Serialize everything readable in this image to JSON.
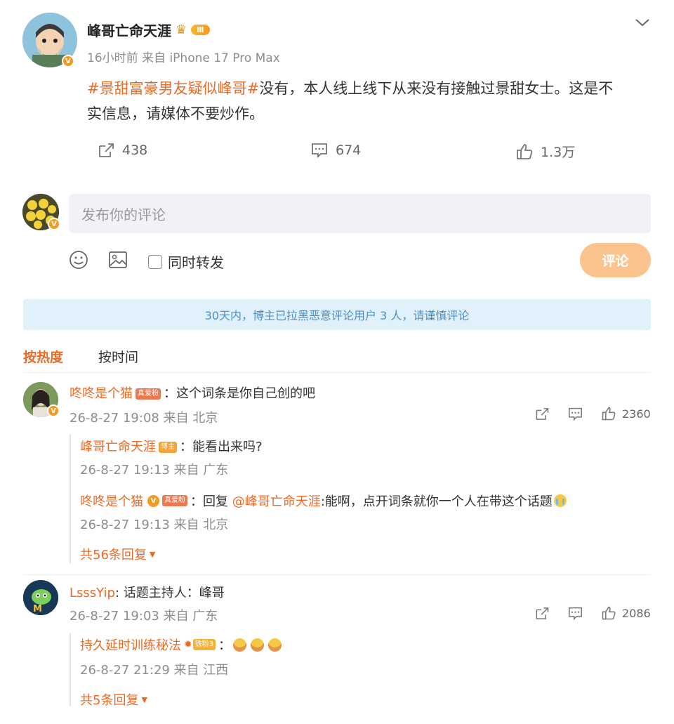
{
  "post": {
    "author": "峰哥亡命天涯",
    "level_badge": "Ⅲ",
    "meta": "16小时前  来自 iPhone 17 Pro Max",
    "topic": "#景甜富豪男友疑似峰哥#",
    "text_line1": "没有，本人线上线下从来没有接触过景甜女士。这是不",
    "text_line2": "实信息，请媒体不要炒作。",
    "reposts": "438",
    "comments": "674",
    "likes": "1.3万"
  },
  "composer": {
    "placeholder": "发布你的评论",
    "repost_label": "同时转发",
    "submit_label": "评论"
  },
  "notice": "30天内，博主已拉黑恶意评论用户 3 人，请谨慎评论",
  "sort_tabs": {
    "hot": "按热度",
    "time": "按时间"
  },
  "comments": [
    {
      "user": "咚咚是个猫",
      "badge": "真爱粉",
      "text": "：这个词条是你自己创的吧",
      "meta": "26-8-27 19:08 来自 北京",
      "likes": "2360",
      "replies": [
        {
          "user": "峰哥亡命天涯",
          "badge": "博主",
          "text": "：能看出来吗?",
          "meta": "26-8-27 19:13 来自 广东"
        },
        {
          "user": "咚咚是个猫",
          "badge": "真爱粉",
          "reply_prefix": "：回复 ",
          "mention": "@峰哥亡命天涯",
          "text": ":能啊，点开词条就你一个人在带这个话题",
          "meta": "26-8-27 19:13 来自 北京"
        }
      ],
      "more": "共56条回复"
    },
    {
      "user": "LsssYip",
      "text": ": 话题主持人：峰哥",
      "meta": "26-8-27 19:03 来自 广东",
      "likes": "2086",
      "replies": [
        {
          "user": "持久延时训练秘法",
          "badge": "铁粉3",
          "text": "：",
          "meta": "26-8-27 21:29 来自 江西"
        }
      ],
      "more": "共5条回复"
    }
  ],
  "colors": {
    "accent": "#ea6b27",
    "notice_bg": "#e1f1fb",
    "notice_text": "#4a90c8",
    "submit_bg": "#fbc48f"
  }
}
